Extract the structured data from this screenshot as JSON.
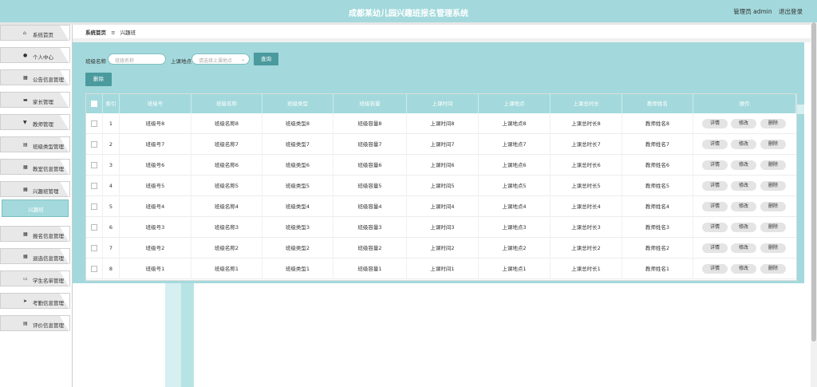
{
  "header": {
    "title": "成都某幼儿园兴趣班报名管理系统",
    "user": "管理员 admin",
    "logout": "退出登录"
  },
  "sidebar": {
    "items": [
      {
        "label": "系统首页",
        "icon": "home-icon",
        "glyph": "⌂"
      },
      {
        "label": "个人中心",
        "icon": "user-icon",
        "glyph": "●"
      },
      {
        "label": "公告信息管理",
        "icon": "grid-icon",
        "glyph": "▦"
      },
      {
        "label": "家长管理",
        "icon": "briefcase-icon",
        "glyph": "▬"
      },
      {
        "label": "教师管理",
        "icon": "trophy-icon",
        "glyph": "▼"
      },
      {
        "label": "班级类型管理",
        "icon": "list-icon",
        "glyph": "▤"
      },
      {
        "label": "教室信息管理",
        "icon": "grid-icon",
        "glyph": "▦"
      },
      {
        "label": "兴趣班管理",
        "icon": "grid-icon",
        "glyph": "▦"
      },
      {
        "label": "报名信息管理",
        "icon": "grid-icon",
        "glyph": "▦"
      },
      {
        "label": "退选信息管理",
        "icon": "grid-icon",
        "glyph": "▦"
      },
      {
        "label": "学生名单管理",
        "icon": "card-icon",
        "glyph": "▭"
      },
      {
        "label": "考勤信息管理",
        "icon": "send-icon",
        "glyph": "➤"
      },
      {
        "label": "评价信息管理",
        "icon": "list-icon",
        "glyph": "▤"
      }
    ],
    "sub_item": "兴趣班"
  },
  "breadcrumb": {
    "home": "系统首页",
    "separator": "≡",
    "current": "兴趣班"
  },
  "search": {
    "class_name_label": "班级名称",
    "class_name_placeholder": "班级名称",
    "location_label": "上课地点",
    "location_placeholder": "请选择上课地点",
    "query_button": "查询"
  },
  "toolbar": {
    "delete_button": "删除"
  },
  "table": {
    "columns": [
      "索引",
      "班级号",
      "班级名称",
      "班级类型",
      "班级容量",
      "上课时间",
      "上课地点",
      "上课总时长",
      "教师姓名",
      "操作"
    ],
    "actions": [
      "详情",
      "修改",
      "删除"
    ],
    "rows": [
      [
        "1",
        "班级号8",
        "班级名称8",
        "班级类型8",
        "班级容量8",
        "上课时间8",
        "上课地点8",
        "上课总时长8",
        "教师姓名8"
      ],
      [
        "2",
        "班级号7",
        "班级名称7",
        "班级类型7",
        "班级容量7",
        "上课时间7",
        "上课地点7",
        "上课总时长7",
        "教师姓名7"
      ],
      [
        "3",
        "班级号6",
        "班级名称6",
        "班级类型6",
        "班级容量6",
        "上课时间6",
        "上课地点6",
        "上课总时长6",
        "教师姓名6"
      ],
      [
        "4",
        "班级号5",
        "班级名称5",
        "班级类型5",
        "班级容量5",
        "上课时间5",
        "上课地点5",
        "上课总时长5",
        "教师姓名5"
      ],
      [
        "5",
        "班级号4",
        "班级名称4",
        "班级类型4",
        "班级容量4",
        "上课时间4",
        "上课地点4",
        "上课总时长4",
        "教师姓名4"
      ],
      [
        "6",
        "班级号3",
        "班级名称3",
        "班级类型3",
        "班级容量3",
        "上课时间3",
        "上课地点3",
        "上课总时长3",
        "教师姓名3"
      ],
      [
        "7",
        "班级号2",
        "班级名称2",
        "班级类型2",
        "班级容量2",
        "上课时间2",
        "上课地点2",
        "上课总时长2",
        "教师姓名2"
      ],
      [
        "8",
        "班级号1",
        "班级名称1",
        "班级类型1",
        "班级容量1",
        "上课时间1",
        "上课地点1",
        "上课总时长1",
        "教师姓名1"
      ]
    ]
  },
  "colors": {
    "primary": "#a3d9dc",
    "button": "#4a9a9e"
  }
}
